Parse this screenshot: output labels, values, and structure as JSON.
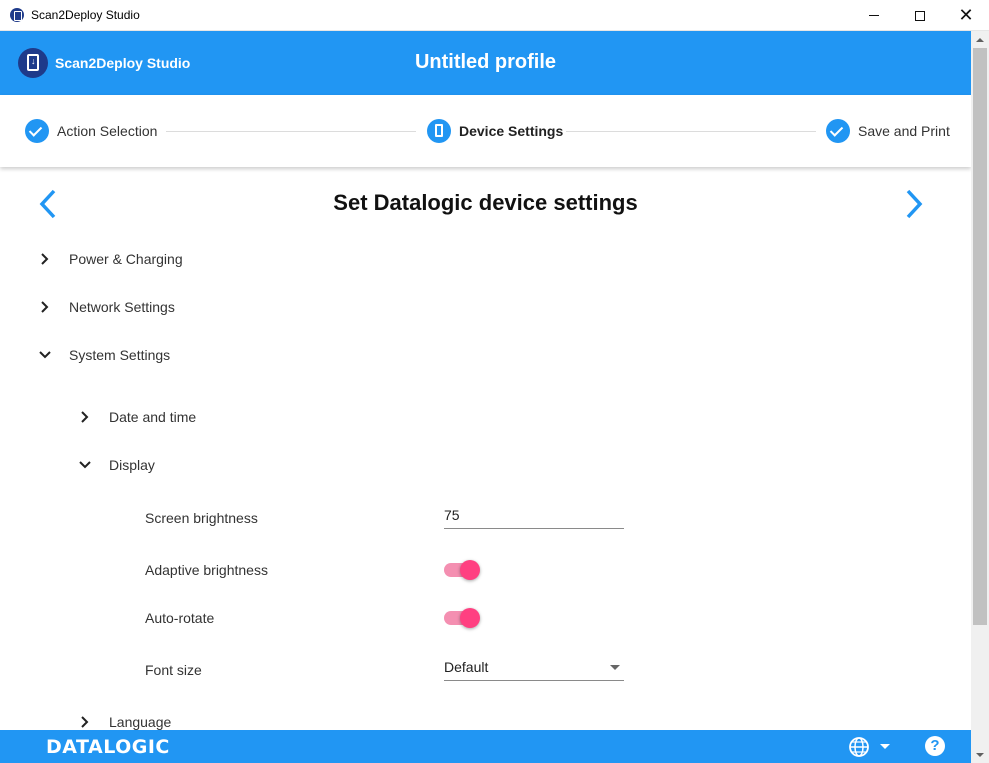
{
  "window": {
    "title": "Scan2Deploy Studio"
  },
  "header": {
    "brand": "Scan2Deploy Studio",
    "profile_title": "Untitled profile",
    "color": "#2196f3"
  },
  "stepper": {
    "steps": [
      {
        "label": "Action Selection",
        "state": "done",
        "icon": "check-icon"
      },
      {
        "label": "Device Settings",
        "state": "current",
        "icon": "device-icon"
      },
      {
        "label": "Save and Print",
        "state": "done",
        "icon": "check-icon"
      }
    ]
  },
  "page": {
    "title": "Set Datalogic device settings"
  },
  "sections": {
    "power": {
      "label": "Power & Charging",
      "expanded": false
    },
    "network": {
      "label": "Network Settings",
      "expanded": false
    },
    "system": {
      "label": "System Settings",
      "expanded": true
    }
  },
  "subsections": {
    "datetime": {
      "label": "Date and time",
      "expanded": false
    },
    "display": {
      "label": "Display",
      "expanded": true
    },
    "language": {
      "label": "Language",
      "expanded": false
    }
  },
  "display": {
    "screen_brightness": {
      "label": "Screen brightness",
      "value": "75"
    },
    "adaptive_brightness": {
      "label": "Adaptive brightness",
      "on": true
    },
    "auto_rotate": {
      "label": "Auto-rotate",
      "on": true
    },
    "font_size": {
      "label": "Font size",
      "value": "Default"
    }
  },
  "footer": {
    "logo": "DATALOGIC",
    "help_label": "?"
  },
  "colors": {
    "accent": "#2196f3",
    "toggle_on": "#ff4081",
    "brand_dark": "#1e3a8a"
  }
}
